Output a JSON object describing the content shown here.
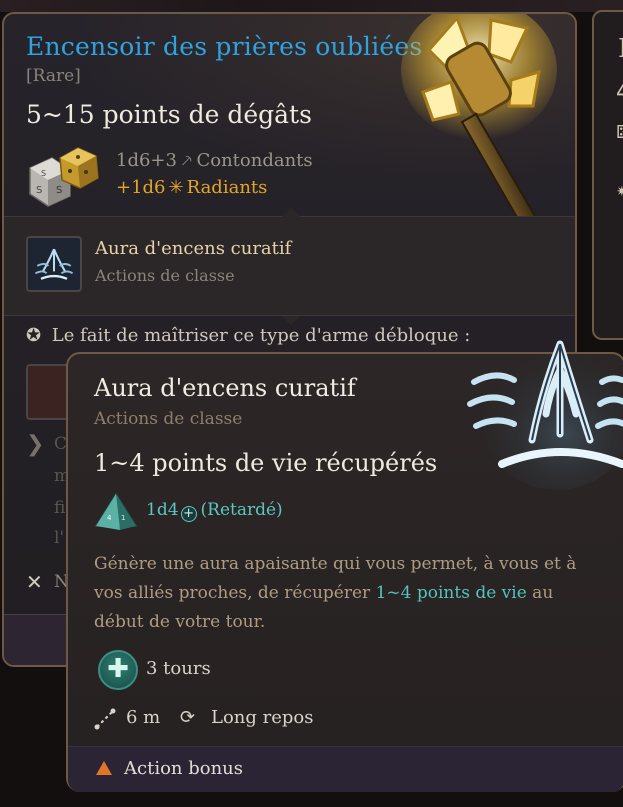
{
  "item": {
    "name": "Encensoir des prières oubliées",
    "rarity": "[Rare]",
    "damage_range": "5~15 points de dégâts",
    "damage_dice": "1d6+3",
    "damage_type": "Contondants",
    "extra_dice": "+1d6",
    "extra_type": "Radiants",
    "icon_names": [
      "dice-pair-icon",
      "bludgeon-icon",
      "radiant-icon",
      "mace-art"
    ]
  },
  "granted_action": {
    "name": "Aura d'encens curatif",
    "category": "Actions de classe",
    "icon": "incense-aura-icon"
  },
  "proficiency": {
    "text": "Le fait de maîtriser ce type d'arme débloque :",
    "icon": "proficiency-badge-icon"
  },
  "tooltip": {
    "title": "Aura d'encens curatif",
    "category": "Actions de classe",
    "heal_range": "1~4 points de vie récupérés",
    "heal_dice": "1d4",
    "heal_tag": "(Retardé)",
    "description_before": "Génère une aura apaisante qui vous permet, à vous et à vos alliés proches, de récupérer ",
    "description_highlight": "1~4 points de vie",
    "description_after": " au début de votre tour.",
    "duration": "3 tours",
    "range": "6 m",
    "recharge": "Long repos",
    "cost": "Action bonus",
    "icon_names": [
      "d4-die-icon",
      "heal-plus-icon",
      "turns-heal-icon",
      "range-icon",
      "long-rest-icon",
      "bonus-action-triangle-icon",
      "incense-fountain-art"
    ]
  },
  "hidden_fragments": {
    "letters": [
      "C",
      "m",
      "fi",
      "l'",
      "N"
    ]
  },
  "right_panel": {
    "letter_top": "I",
    "digit": "4"
  },
  "colors": {
    "item_title": "#2fa2df",
    "radiant": "#e4a52a",
    "heal_teal": "#52c3bd",
    "border_gold": "#6e5a44",
    "bonus_action": "#e3752b"
  }
}
